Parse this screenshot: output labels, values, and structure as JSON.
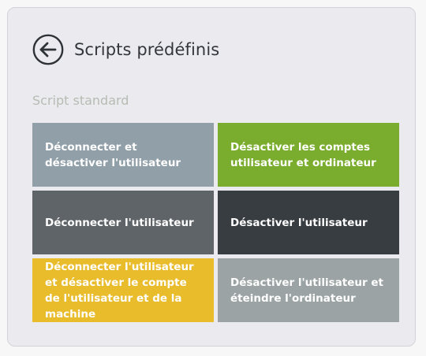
{
  "header": {
    "title": "Scripts prédéfinis"
  },
  "section": {
    "label": "Script standard"
  },
  "tiles": [
    {
      "label": "Déconnecter et désactiver l'utilisateur",
      "color": "#919fa8"
    },
    {
      "label": "Désactiver les comptes utilisateur et ordinateur",
      "color": "#7aad2d"
    },
    {
      "label": "Déconnecter l'utilisateur",
      "color": "#5f6468"
    },
    {
      "label": "Désactiver l'utilisateur",
      "color": "#383d41"
    },
    {
      "label": "Déconnecter l'utilisateur et désactiver le compte de l'utilisateur et de la machine",
      "color": "#e9bc2c"
    },
    {
      "label": "Désactiver l'utilisateur et éteindre l'ordinateur",
      "color": "#9ca3a5"
    }
  ],
  "icons": {
    "back": "arrow-left-circle-icon"
  }
}
